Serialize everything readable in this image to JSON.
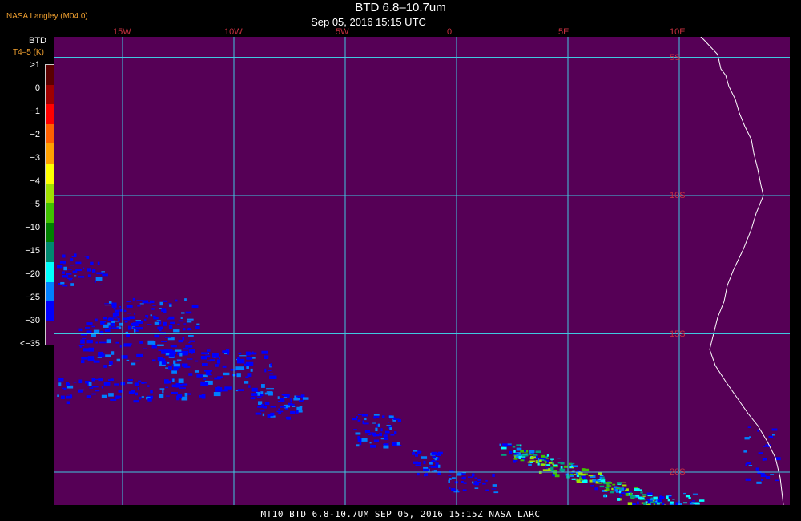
{
  "header": {
    "title": "BTD 6.8–10.7um",
    "subtitle": "Sep 05, 2016 15:15 UTC",
    "source": "NASA Langley (M04.0)"
  },
  "footer": {
    "text": "MT10  BTD 6.8-10.7UM   SEP 05, 2016 15:15Z   NASA LARC"
  },
  "legend": {
    "title": "BTD",
    "unit": "T4–5 (K)",
    "labels": [
      ">1",
      "0",
      "−1",
      "−2",
      "−3",
      "−4",
      "−5",
      "−10",
      "−15",
      "−20",
      "−25",
      "−30",
      "<−35"
    ],
    "colors": [
      "#5a0000",
      "#a00000",
      "#ff0000",
      "#ff6000",
      "#ffa000",
      "#ffff00",
      "#a0e000",
      "#40c000",
      "#008000",
      "#008870",
      "#00ffff",
      "#0080ff",
      "#0000ff",
      "#560056"
    ]
  },
  "grid": {
    "longitudes": [
      {
        "lon": -15,
        "label": "15W"
      },
      {
        "lon": -10,
        "label": "10W"
      },
      {
        "lon": -5,
        "label": "5W"
      },
      {
        "lon": 0,
        "label": "0"
      },
      {
        "lon": 5,
        "label": "5E"
      },
      {
        "lon": 10,
        "label": "10E"
      }
    ],
    "latitudes": [
      {
        "lat": -5,
        "label": "5S"
      },
      {
        "lat": -10,
        "label": "10S"
      },
      {
        "lat": -15,
        "label": "15S"
      },
      {
        "lat": -20,
        "label": "20S"
      }
    ],
    "line_color": "#40c8e0",
    "background_color": "#560056"
  }
}
